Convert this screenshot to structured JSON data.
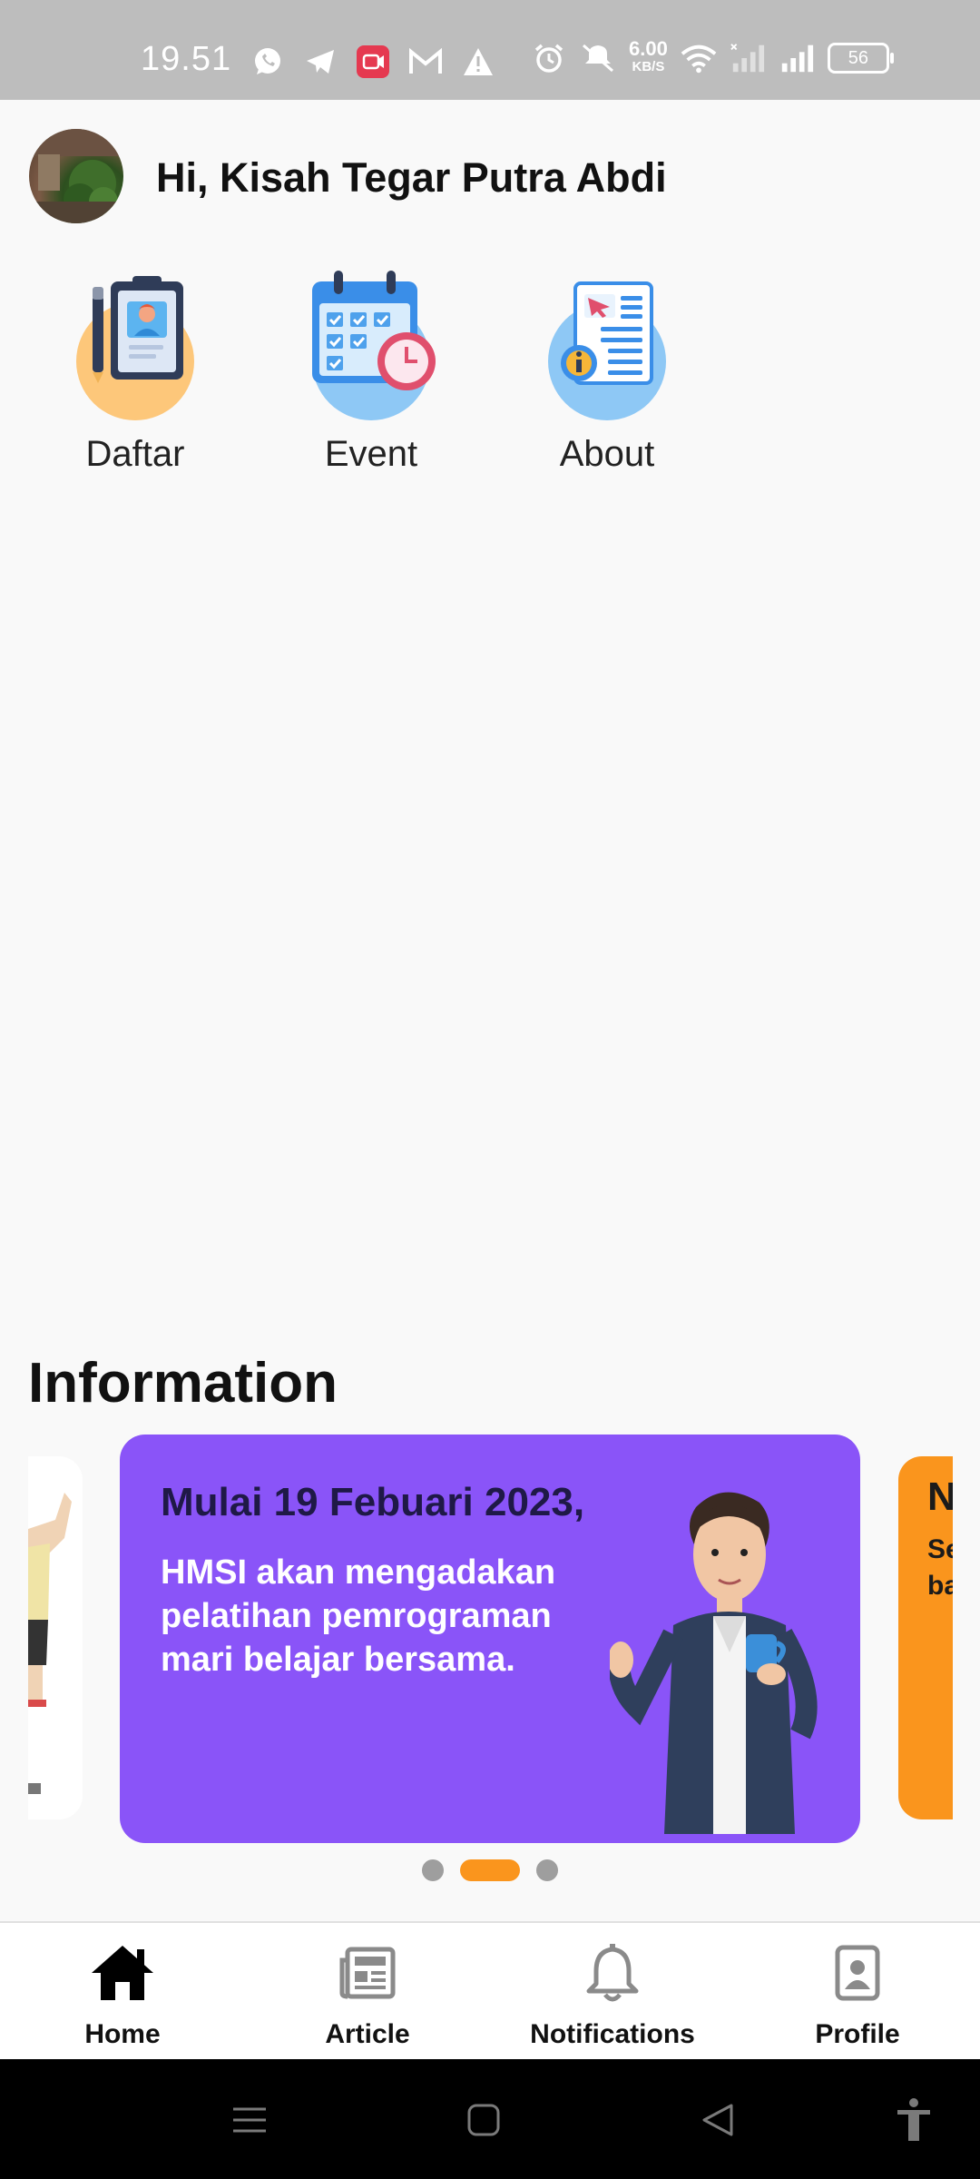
{
  "status_bar": {
    "time": "19.51",
    "net_speed_value": "6.00",
    "net_speed_unit": "KB/S",
    "battery": "56",
    "left_icons": [
      "whatsapp-icon",
      "telegram-icon",
      "screen-record-icon",
      "gmail-icon",
      "warning-icon"
    ],
    "right_icons": [
      "alarm-icon",
      "mute-icon",
      "wifi-icon",
      "signal-x-icon",
      "signal-icon"
    ]
  },
  "header": {
    "greeting": "Hi, Kisah Tegar Putra Abdi"
  },
  "menu": [
    {
      "label": "Daftar",
      "icon": "clipboard-register-icon"
    },
    {
      "label": "Event",
      "icon": "calendar-event-icon"
    },
    {
      "label": "About",
      "icon": "document-info-icon"
    }
  ],
  "information": {
    "title": "Information",
    "card": {
      "heading": "Mulai 19 Febuari 2023,",
      "body": "HMSI akan mengadakan pelatihan pemrograman mari belajar bersama."
    },
    "next_card_peek": {
      "line1": "N",
      "line2": "Se",
      "line3": "ba"
    },
    "carousel_active_index": 1,
    "carousel_count": 3
  },
  "bottom_nav": [
    {
      "label": "Home",
      "icon": "home-icon",
      "active": true
    },
    {
      "label": "Article",
      "icon": "article-icon",
      "active": false
    },
    {
      "label": "Notifications",
      "icon": "bell-icon",
      "active": false
    },
    {
      "label": "Profile",
      "icon": "profile-icon",
      "active": false
    }
  ],
  "colors": {
    "accent": "#fa951d",
    "card_purple": "#8a54f8",
    "inactive_icon": "#8a8a8a"
  }
}
